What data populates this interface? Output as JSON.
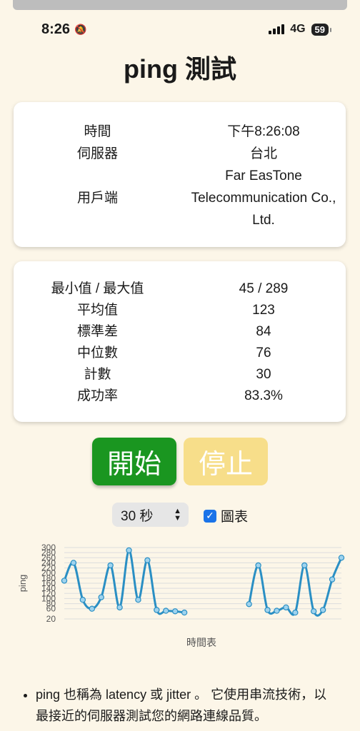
{
  "status_bar": {
    "time": "8:26",
    "network": "4G",
    "battery": "59"
  },
  "page": {
    "title": "ping 測試"
  },
  "info_card": {
    "rows": [
      {
        "label": "時間",
        "value": "下午8:26:08"
      },
      {
        "label": "伺服器",
        "value": "台北"
      },
      {
        "label": "用戶端",
        "value_lines": [
          "Far EasTone",
          "Telecommunication Co.,",
          "Ltd."
        ]
      }
    ]
  },
  "stats_card": {
    "rows": [
      {
        "label": "最小值 / 最大值",
        "value": "45 / 289"
      },
      {
        "label": "平均值",
        "value": "123"
      },
      {
        "label": "標準差",
        "value": "84"
      },
      {
        "label": "中位數",
        "value": "76"
      },
      {
        "label": "計數",
        "value": "30"
      },
      {
        "label": "成功率",
        "value": "83.3%"
      }
    ]
  },
  "controls": {
    "start_label": "開始",
    "stop_label": "停止",
    "duration_select": "30 秒",
    "chart_checkbox_label": "圖表",
    "chart_checked": true
  },
  "chart_data": {
    "type": "line",
    "title": "",
    "xlabel": "時間表",
    "ylabel": "ping",
    "ylim": [
      20,
      300
    ],
    "yticks": [
      20,
      60,
      80,
      100,
      120,
      140,
      160,
      180,
      200,
      220,
      240,
      260,
      280,
      300
    ],
    "grid": true,
    "series": [
      {
        "color": "#2a8fc4",
        "values": [
          170,
          240,
          95,
          60,
          105,
          230,
          65,
          289,
          95,
          250,
          55,
          52,
          50,
          45,
          null,
          null,
          null,
          null,
          null,
          null,
          78,
          230,
          55,
          52,
          65,
          45,
          230,
          50,
          55,
          175,
          260
        ]
      }
    ]
  },
  "description": {
    "text": "ping 也稱為 latency 或 jitter 。 它使用串流技術，以最接近的伺服器測試您的網路連線品質。"
  },
  "colors": {
    "background": "#fcf6e8",
    "start": "#1a9620",
    "stop": "#f7de8a",
    "line": "#2a8fc4"
  }
}
